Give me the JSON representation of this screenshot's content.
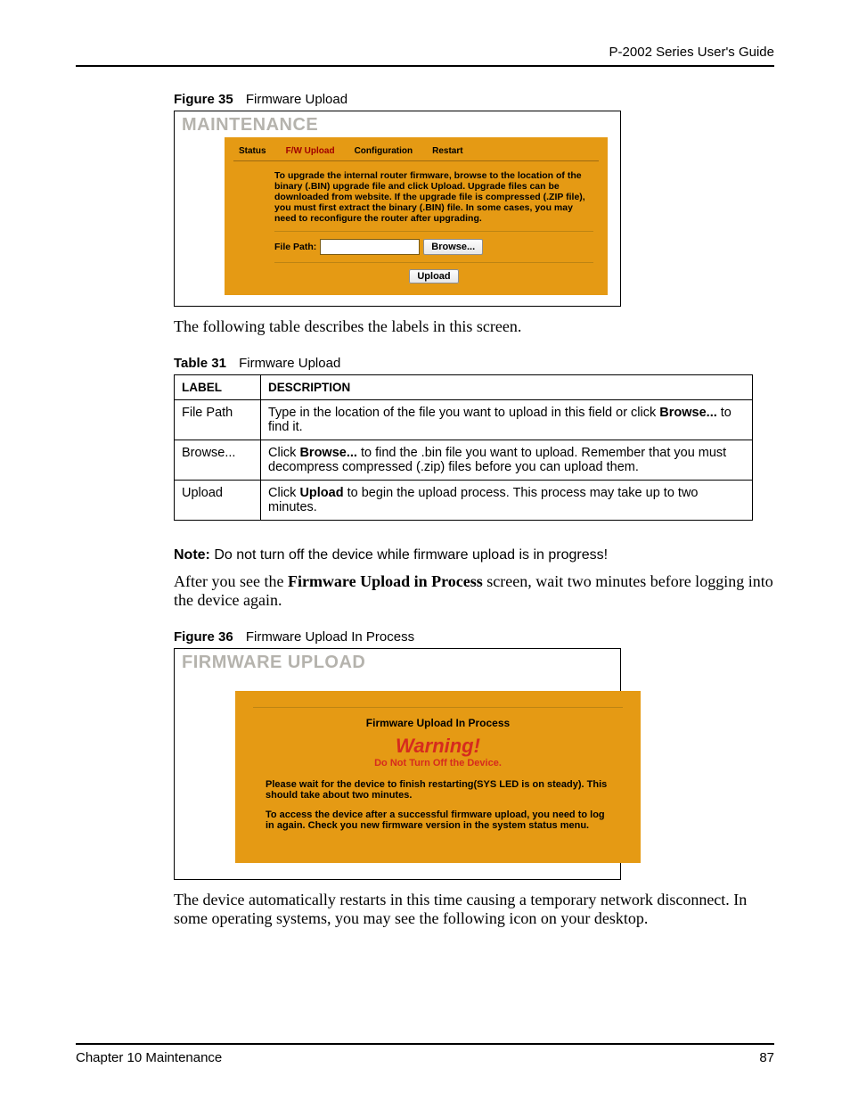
{
  "header_right": "P-2002 Series User's Guide",
  "fig35": {
    "caption_num": "Figure 35",
    "caption_txt": "Firmware Upload",
    "title": "MAINTENANCE",
    "tabs": [
      "Status",
      "F/W Upload",
      "Configuration",
      "Restart"
    ],
    "instr": "To upgrade the internal router firmware, browse to the location of the binary (.BIN) upgrade file and click Upload. Upgrade files can be downloaded from website. If the upgrade file is compressed (.ZIP file), you must first extract the binary (.BIN) file. In some cases, you may need to reconfigure the router after upgrading.",
    "file_path_label": "File Path:",
    "browse_btn": "Browse...",
    "upload_btn": "Upload"
  },
  "intro_sentence": "The following table describes the labels in this screen.",
  "table31": {
    "caption_num": "Table 31",
    "caption_txt": "Firmware Upload",
    "head": [
      "LABEL",
      "DESCRIPTION"
    ],
    "rows": [
      {
        "label": "File Path",
        "desc_pre": "Type in the location of the file you want to upload in this field or click ",
        "desc_b": "Browse...",
        "desc_post": " to find it."
      },
      {
        "label": "Browse...",
        "desc_pre": "Click ",
        "desc_b": "Browse...",
        "desc_post": " to find the .bin file you want to upload. Remember that you must decompress compressed (.zip) files before you can upload them."
      },
      {
        "label": "Upload",
        "desc_pre": "Click ",
        "desc_b": "Upload",
        "desc_post": " to begin the upload process. This process may take up to two minutes."
      }
    ]
  },
  "note_label": "Note:",
  "note_text": " Do not turn off the device while firmware upload is in progress!",
  "after_text_pre": "After you see the ",
  "after_text_b": "Firmware Upload in Process",
  "after_text_post": " screen, wait two minutes before logging into the device again.",
  "fig36": {
    "caption_num": "Figure 36",
    "caption_txt": "Firmware Upload In Process",
    "title": "FIRMWARE UPLOAD",
    "heading": "Firmware Upload In Process",
    "warning": "Warning!",
    "donotturn": "Do Not Turn Off the Device.",
    "p1": "Please wait for the device to finish restarting(SYS LED is on steady). This should take about two minutes.",
    "p2": "To access the device after a successful firmware upload, you need to log in again. Check you new firmware version in the system status menu."
  },
  "para_last": "The device automatically restarts in this time causing a temporary network disconnect. In some operating systems, you may see the following icon on your desktop.",
  "footer_left": "Chapter 10 Maintenance",
  "footer_right": "87"
}
